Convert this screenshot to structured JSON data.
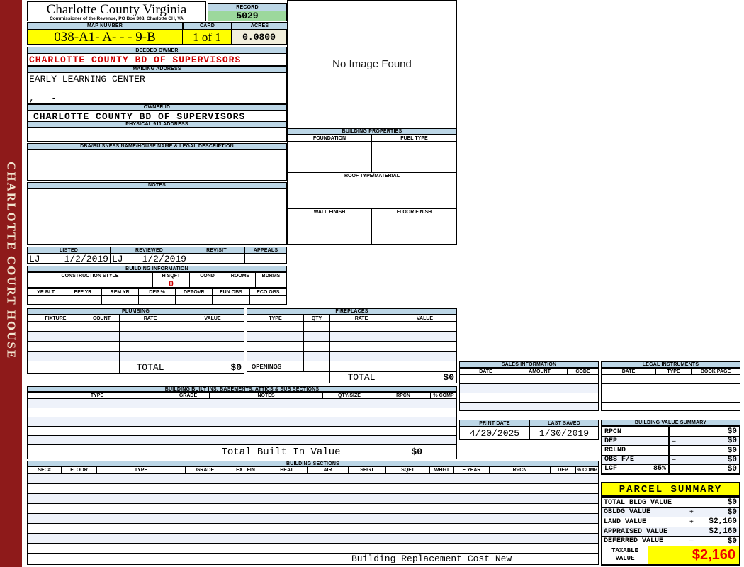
{
  "colors": {
    "sidebar_maroon": "#8E1A1A",
    "header_blue": "#BCD6E6",
    "record_green": "#9CD89C",
    "highlight_yellow": "#FFFF00",
    "acres_cream": "#F2EFDC",
    "owner_red": "#CC0000",
    "taxable_red": "#EE0000",
    "alt_row": "#EEF2FA"
  },
  "sidebar": {
    "title": "CHARLOTTE COURT HOUSE"
  },
  "header": {
    "county": "Charlotte County Virginia",
    "commissioner": "Commissioner of the Revenue, PO Box 308, Charlotte CH, VA",
    "record_label": "RECORD",
    "record_value": "5029",
    "map_number_label": "MAP NUMBER",
    "map_number_value": "038-A1- A-  -  -  9-B",
    "card_label": "CARD",
    "card_value": "1 of 1",
    "acres_label": "ACRES",
    "acres_value": "0.0800"
  },
  "owner": {
    "deeded_owner_label": "DEEDED OWNER",
    "deeded_owner_value": "CHARLOTTE COUNTY BD OF SUPERVISORS",
    "mailing_address_label": "MAILING ADDRESS",
    "mailing_address_line1": "EARLY LEARNING CENTER",
    "mailing_address_line2": ",   -",
    "owner_id_label": "OWNER ID",
    "owner_id_value": "CHARLOTTE COUNTY BD OF SUPERVISORS",
    "physical_address_label": "PHYSICAL 911 ADDRESS",
    "dba_label": "DBA/BUISNESS NAME/HOUSE NAME & LEGAL DESCRIPTION",
    "notes_label": "NOTES"
  },
  "review": {
    "headers": [
      "LISTED",
      "REVIEWED",
      "REVISIT",
      "APPEALS"
    ],
    "listed_by": "LJ",
    "listed_date": "1/2/2019",
    "reviewed_by": "LJ",
    "reviewed_date": "1/2/2019"
  },
  "building_information": {
    "title": "BUILDING INFORMATION",
    "style_headers": [
      "CONSTRUCTION STYLE",
      "H SQFT",
      "COND",
      "ROOMS",
      "BDRMS"
    ],
    "h_sqft_value": "0",
    "year_headers": [
      "YR BLT",
      "EFF YR",
      "REM YR",
      "DEP %",
      "DEPOVR",
      "FUN OBS",
      "ECO OBS"
    ]
  },
  "plumbing": {
    "title": "PLUMBING",
    "headers": [
      "FIXTURE",
      "COUNT",
      "RATE",
      "VALUE"
    ],
    "total_label": "TOTAL",
    "total_value": "$0"
  },
  "fireplaces": {
    "title": "FIREPLACES",
    "headers": [
      "TYPE",
      "QTY",
      "RATE",
      "VALUE"
    ],
    "openings_label": "OPENINGS",
    "total_label": "TOTAL",
    "total_value": "$0"
  },
  "built_ins": {
    "title": "BUILDING BUILT INS, BASEMENTS, ATTICS & SUB SECTIONS",
    "headers": [
      "TYPE",
      "GRADE",
      "NOTES",
      "QTY/SIZE",
      "RPCN",
      "% COMP"
    ],
    "total_label": "Total Built In Value",
    "total_value": "$0"
  },
  "building_sections": {
    "title": "BUILDING SECTIONS",
    "headers": [
      "SEC#",
      "FLOOR",
      "TYPE",
      "GRADE",
      "EXT FIN",
      "HEAT",
      "AIR",
      "SHGT",
      "SQFT",
      "WHGT",
      "E YEAR",
      "RPCN",
      "DEP",
      "% COMP"
    ],
    "footer": "Building Replacement Cost New"
  },
  "image_panel": {
    "no_image_text": "No Image Found"
  },
  "building_properties": {
    "title": "BUILDING PROPERTIES",
    "foundation_label": "FOUNDATION",
    "fuel_type_label": "FUEL TYPE",
    "roof_label": "ROOF TYPE/MATERIAL",
    "wall_finish_label": "WALL FINISH",
    "floor_finish_label": "FLOOR FINISH"
  },
  "sales_information": {
    "title": "SALES INFORMATION",
    "headers": [
      "DATE",
      "AMOUNT",
      "CODE"
    ]
  },
  "legal_instruments": {
    "title": "LEGAL INSTRUMENTS",
    "headers": [
      "DATE",
      "TYPE",
      "BOOK PAGE"
    ]
  },
  "print_info": {
    "print_date_label": "PRINT DATE",
    "print_date_value": "4/20/2025",
    "last_saved_label": "LAST SAVED",
    "last_saved_value": "1/30/2019"
  },
  "building_value_summary": {
    "title": "BUILDING VALUE SUMMARY",
    "rows": [
      {
        "label": "RPCN",
        "suffix": "",
        "op": "",
        "value": "$0"
      },
      {
        "label": "DEP",
        "suffix": "",
        "op": "–",
        "value": "$0"
      },
      {
        "label": "RCLND",
        "suffix": "",
        "op": "",
        "value": "$0"
      },
      {
        "label": "OBS F/E",
        "suffix": "",
        "op": "–",
        "value": "$0"
      },
      {
        "label": "LCF",
        "suffix": "85%",
        "op": "",
        "value": "$0"
      }
    ]
  },
  "parcel_summary": {
    "title": "PARCEL SUMMARY",
    "rows": [
      {
        "label": "TOTAL BLDG VALUE",
        "op": "",
        "value": "$0"
      },
      {
        "label": "OBLDG VALUE",
        "op": "+",
        "value": "$0"
      },
      {
        "label": "LAND VALUE",
        "op": "+",
        "value": "$2,160"
      },
      {
        "label": "APPRAISED VALUE",
        "op": "",
        "value": "$2,160"
      },
      {
        "label": "DEFERRED VALUE",
        "op": "–",
        "value": "$0"
      }
    ],
    "taxable_label": "TAXABLE VALUE",
    "taxable_value": "$2,160"
  }
}
